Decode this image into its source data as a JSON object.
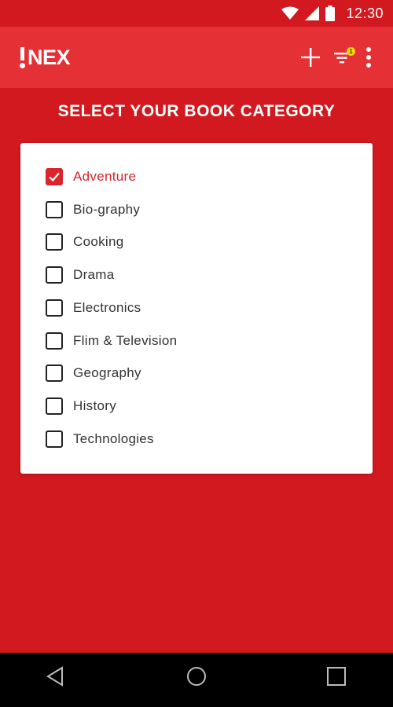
{
  "status_bar": {
    "time": "12:30"
  },
  "app_bar": {
    "logo_text": "NEX",
    "filter_badge_count": "1"
  },
  "page": {
    "title": "SELECT YOUR BOOK CATEGORY"
  },
  "categories": [
    {
      "label": "Adventure",
      "checked": true
    },
    {
      "label": "Bio-graphy",
      "checked": false
    },
    {
      "label": "Cooking",
      "checked": false
    },
    {
      "label": "Drama",
      "checked": false
    },
    {
      "label": "Electronics",
      "checked": false
    },
    {
      "label": "Flim & Television",
      "checked": false
    },
    {
      "label": "Geography",
      "checked": false
    },
    {
      "label": "History",
      "checked": false
    },
    {
      "label": "Technologies",
      "checked": false
    }
  ],
  "colors": {
    "brand_red": "#d1191f",
    "app_bar": "#e53036",
    "accent": "#d9252b",
    "badge": "#f5d60e"
  },
  "icons": [
    "wifi-icon",
    "signal-icon",
    "battery-icon",
    "plus-icon",
    "filter-icon",
    "more-vert-icon",
    "back-icon",
    "home-icon",
    "recents-icon"
  ]
}
